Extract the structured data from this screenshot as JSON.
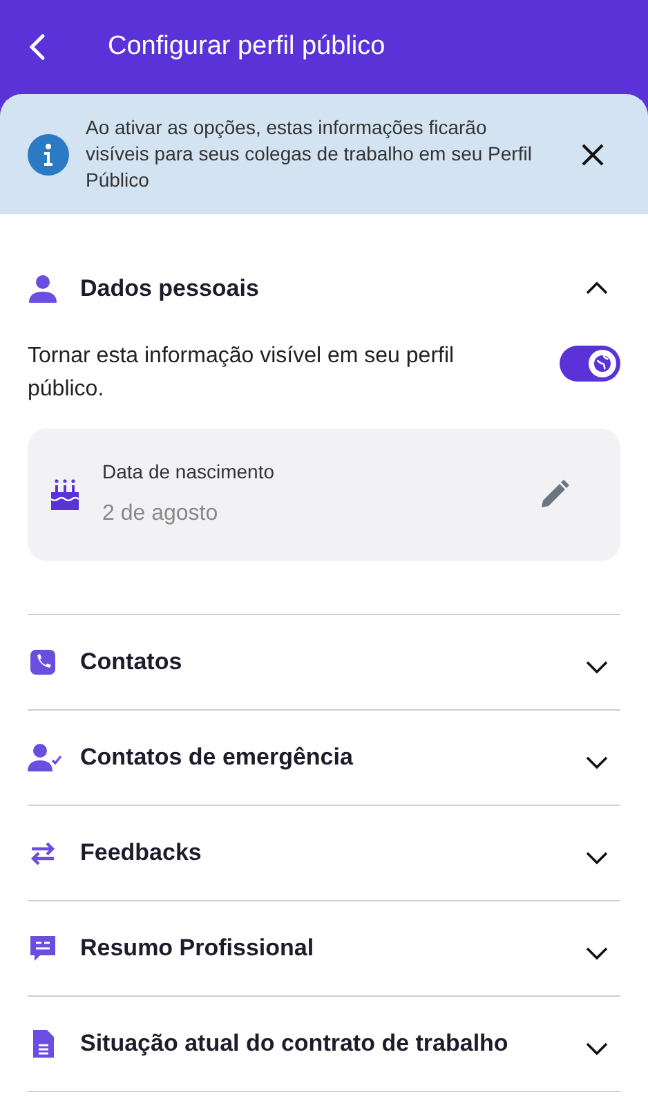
{
  "header": {
    "title": "Configurar perfil público"
  },
  "banner": {
    "text": "Ao ativar as opções, estas informações ficarão visíveis para seus colegas de trabalho em seu Perfil Público"
  },
  "sections": [
    {
      "title": "Dados pessoais",
      "expanded": true,
      "visibility_text": "Tornar esta informação visível em seu perfil público.",
      "visible": true,
      "fields": [
        {
          "label": "Data de nascimento",
          "value": "2 de agosto"
        }
      ]
    },
    {
      "title": "Contatos",
      "expanded": false
    },
    {
      "title": "Contatos de emergência",
      "expanded": false
    },
    {
      "title": "Feedbacks",
      "expanded": false
    },
    {
      "title": "Resumo Profissional",
      "expanded": false
    },
    {
      "title": "Situação atual do contrato de trabalho",
      "expanded": false
    }
  ]
}
